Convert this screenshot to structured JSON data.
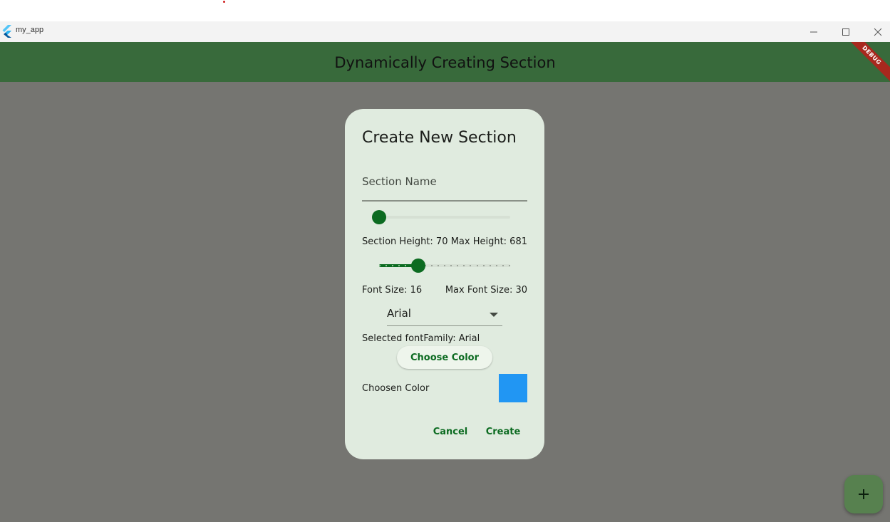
{
  "window": {
    "title": "my_app",
    "minimize_icon": "minimize-icon",
    "maximize_icon": "maximize-icon",
    "close_icon": "close-icon"
  },
  "appbar": {
    "title": "Dynamically Creating Section",
    "debug_banner": "DEBUG"
  },
  "dialog": {
    "title": "Create New Section",
    "section_name": {
      "placeholder": "Section Name",
      "value": ""
    },
    "height_slider": {
      "value_fraction": 0.0
    },
    "height_row": {
      "section_height_label": "Section Height: 70",
      "max_height_label": "Max Height: 681"
    },
    "font_slider": {
      "value_fraction": 0.3
    },
    "font_row": {
      "font_size_label": "Font Size: 16",
      "max_font_size_label": "Max Font Size: 30"
    },
    "font_dropdown": {
      "selected": "Arial"
    },
    "selected_font_label": "Selected fontFamily: Arial",
    "choose_color_button": "Choose Color",
    "chosen_color_label": "Choosen Color",
    "chosen_color": "#2196f3",
    "cancel_button": "Cancel",
    "create_button": "Create"
  },
  "fab": {
    "label": "+",
    "icon": "add-icon"
  },
  "colors": {
    "accent": "#0c6b21",
    "appbar": "#386a3b",
    "dialog_bg": "#e0ebdf",
    "scrim": "#757571"
  }
}
